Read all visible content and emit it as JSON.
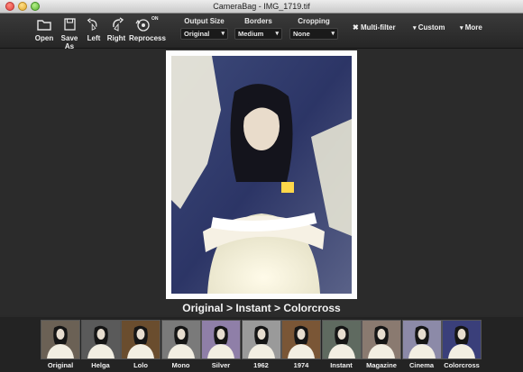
{
  "window": {
    "title": "CameraBag - IMG_1719.tif"
  },
  "toolbar": {
    "open": "Open",
    "save_as": "Save As",
    "left": "Left",
    "right": "Right",
    "reprocess": "Reprocess",
    "reprocess_badge": "ON",
    "output_size": {
      "title": "Output Size",
      "value": "Original"
    },
    "borders": {
      "title": "Borders",
      "value": "Medium"
    },
    "cropping": {
      "title": "Cropping",
      "value": "None"
    },
    "multifilter": "Multi-filter",
    "custom": "Custom",
    "more": "More"
  },
  "preview": {
    "recipe": "Original > Instant > Colorcross"
  },
  "filters": [
    {
      "label": "Original",
      "tint": "#6b6155"
    },
    {
      "label": "Helga",
      "tint": "#5a5a5a"
    },
    {
      "label": "Lolo",
      "tint": "#6a4d2e"
    },
    {
      "label": "Mono",
      "tint": "#7a7a7a"
    },
    {
      "label": "Silver",
      "tint": "#8f7fa8"
    },
    {
      "label": "1962",
      "tint": "#9a9a9a"
    },
    {
      "label": "1974",
      "tint": "#7a5636"
    },
    {
      "label": "Instant",
      "tint": "#5f6a60"
    },
    {
      "label": "Magazine",
      "tint": "#8a7a70"
    },
    {
      "label": "Cinema",
      "tint": "#8c8aa8"
    },
    {
      "label": "Colorcross",
      "tint": "#3a3f7a"
    }
  ]
}
